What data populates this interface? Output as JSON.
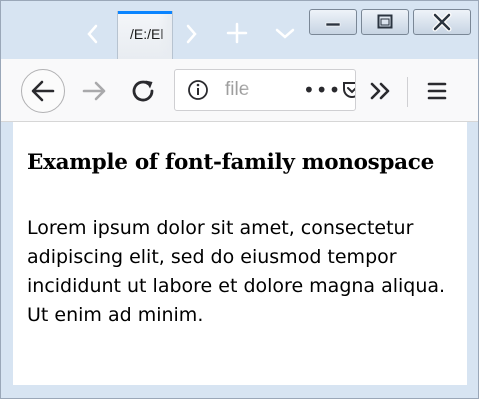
{
  "browser": {
    "tab": {
      "title": "/E:/El"
    },
    "urlbar": {
      "text": "file",
      "page_actions": "•••"
    },
    "icons": {
      "back": "arrow-left-icon",
      "forward": "arrow-right-icon",
      "reload": "reload-icon",
      "info": "info-icon",
      "pocket": "pocket-icon",
      "overflow": "double-chevron-icon",
      "menu": "hamburger-icon",
      "new_tab": "plus-icon",
      "all_tabs": "chevron-down-icon",
      "tab_scroll_left": "chevron-left-icon",
      "tab_scroll_right": "chevron-right-icon",
      "minimize": "minimize-icon",
      "maximize": "maximize-icon",
      "close": "close-icon"
    },
    "colors": {
      "accent": "#0a84ff",
      "frame": "#d7e4f2",
      "toolbar": "#f9f9fa"
    }
  },
  "page": {
    "heading": "Example of font-family monospace",
    "paragraph": "Lorem ipsum dolor sit amet, consectetur adipiscing elit, sed do eiusmod tempor incididunt ut labore et dolore magna aliqua. Ut enim ad minim."
  }
}
